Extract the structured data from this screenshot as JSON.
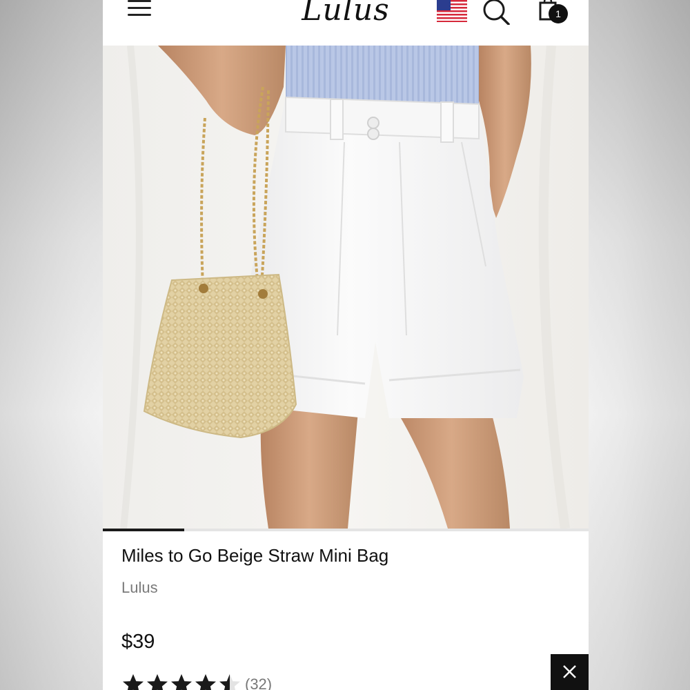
{
  "header": {
    "logo_text": "Lulus",
    "cart_count": "1",
    "icons": [
      "menu-icon",
      "us-flag-icon",
      "search-icon",
      "cart-icon"
    ]
  },
  "gallery": {
    "active_slide_fraction": 0.167
  },
  "product": {
    "title": "Miles to Go Beige Straw Mini Bag",
    "brand": "Lulus",
    "price": "$39",
    "rating_value": 4.5,
    "rating_max": 5,
    "review_count": "(32)"
  },
  "colors": {
    "text": "#111111",
    "muted": "#7a7a7a",
    "star": "#1a1a1a",
    "overlay_button": "#111111"
  }
}
